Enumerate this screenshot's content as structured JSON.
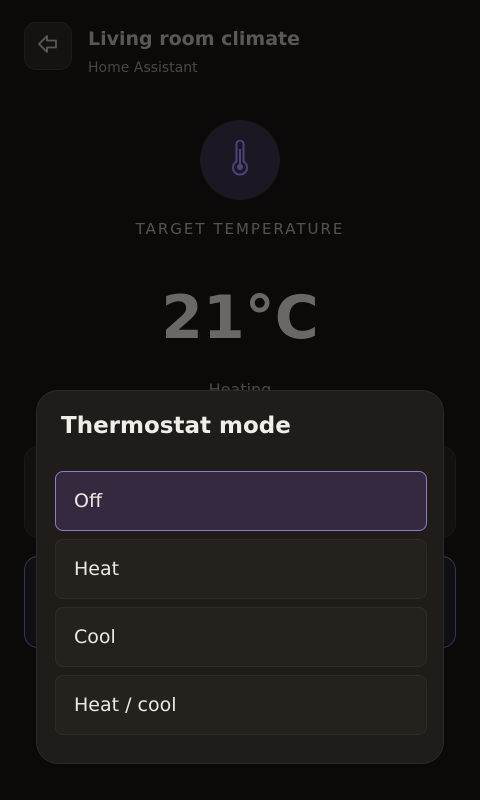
{
  "header": {
    "title": "Living room climate",
    "subtitle": "Home Assistant",
    "back_icon": "back-arrow-icon"
  },
  "climate": {
    "icon": "thermometer-icon",
    "target_label": "TARGET TEMPERATURE",
    "target_temperature": "21°C",
    "mode_peek": "Heating"
  },
  "sheet": {
    "title": "Thermostat mode",
    "options": [
      {
        "label": "Off",
        "selected": true
      },
      {
        "label": "Heat",
        "selected": false
      },
      {
        "label": "Cool",
        "selected": false
      },
      {
        "label": "Heat / cool",
        "selected": false
      }
    ]
  },
  "colors": {
    "accent": "#8f7ec2",
    "selected_bg": "#34293f",
    "sheet_bg": "#1f1c19",
    "page_bg": "#0b0a09"
  }
}
